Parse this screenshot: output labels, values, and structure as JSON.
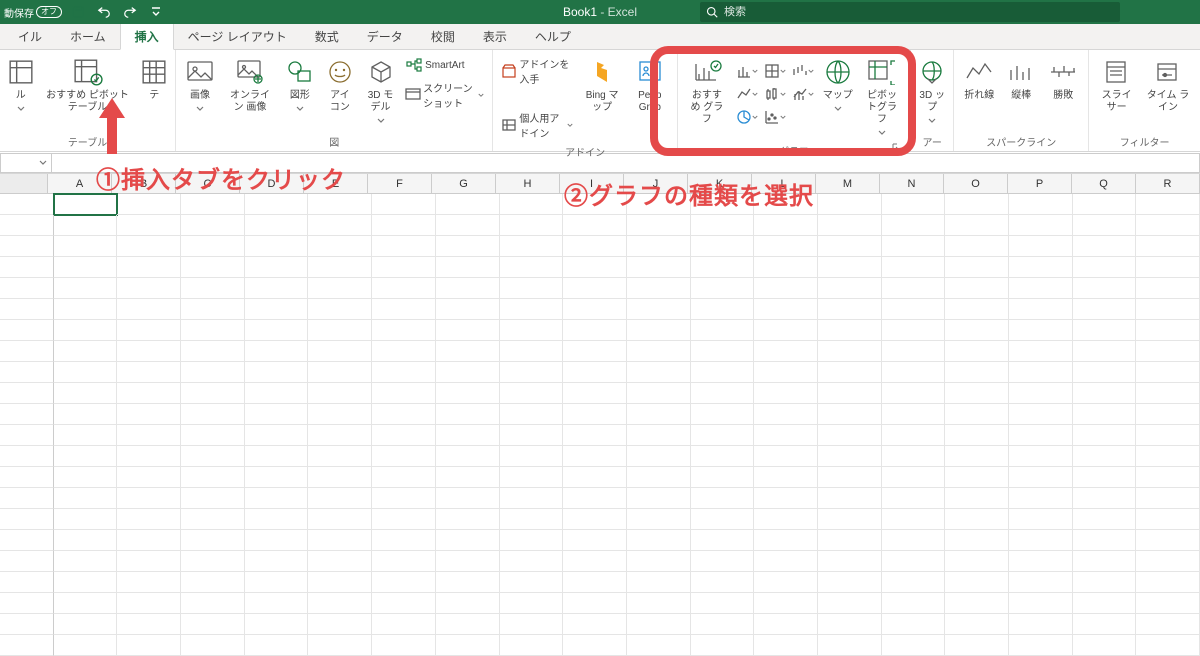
{
  "titlebar": {
    "autosave_label": "動保存",
    "autosave_state": "オフ",
    "document_title": "Book1",
    "app_suffix": " - Excel",
    "search_placeholder": "検索"
  },
  "tabs": {
    "items": [
      {
        "label": "イル"
      },
      {
        "label": "ホーム"
      },
      {
        "label": "挿入"
      },
      {
        "label": "ページ レイアウト"
      },
      {
        "label": "数式"
      },
      {
        "label": "データ"
      },
      {
        "label": "校閲"
      },
      {
        "label": "表示"
      },
      {
        "label": "ヘルプ"
      }
    ],
    "active": 2
  },
  "ribbon": {
    "tables": {
      "label": "テーブル",
      "pivot_btn": "ル",
      "recommend_pivot": "おすすめ\nピボットテーブル",
      "table": "テ\n"
    },
    "illustrations": {
      "group_label": "図",
      "pictures": "画像",
      "online_pictures": "オンライン\n画像",
      "shapes": "図形",
      "icons": "アイ\nコン",
      "threeD_models": "3D\nモデル",
      "smartart": "SmartArt",
      "screenshot": "スクリーンショット"
    },
    "addins": {
      "group_label": "アドイン",
      "get_addins": "アドインを入手",
      "my_addins": "個人用アドイン",
      "bing": "Bing\nマップ",
      "people": "Peop\nGrap"
    },
    "charts": {
      "group_label": "グラフ",
      "recommend": "おすすめ\nグラフ",
      "map": "マップ",
      "pivotchart": "ピボットグラフ"
    },
    "tours": {
      "group_label": "アー",
      "threeD_map": "3D\nップ"
    },
    "sparklines": {
      "group_label": "スパークライン",
      "line": "折れ線",
      "column": "縦棒",
      "winloss": "勝敗"
    },
    "filters": {
      "group_label": "フィルター",
      "slicer": "スライサー",
      "timeline": "タイム\nライン"
    }
  },
  "grid": {
    "columns": [
      "A",
      "B",
      "C",
      "D",
      "E",
      "F",
      "G",
      "H",
      "I",
      "J",
      "K",
      "L",
      "M",
      "N",
      "O",
      "P",
      "Q",
      "R"
    ],
    "row_count": 22,
    "selected": "A1"
  },
  "annotations": {
    "one": "①挿入タブをクリック",
    "two": "②グラフの種類を選択"
  }
}
